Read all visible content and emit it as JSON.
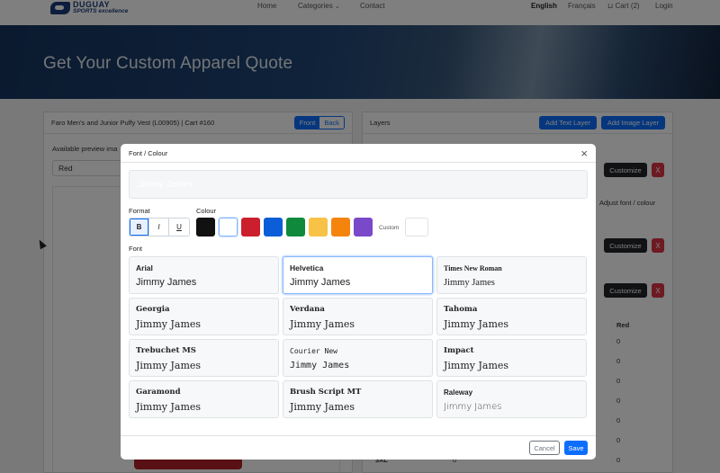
{
  "nav": {
    "logo_name": "DUGUAY",
    "logo_tagline": "SPORTS excellence",
    "links": [
      "Home",
      "Categories",
      "Contact"
    ],
    "lang_active": "English",
    "lang_other": "Français",
    "cart": "Cart (2)",
    "login": "Login"
  },
  "hero": {
    "title": "Get Your Custom Apparel Quote"
  },
  "product_panel": {
    "title": "Faro Men's and Junior Puffy Vest (L00905) | Cart #160",
    "front_label": "Front",
    "back_label": "Back",
    "preview_label": "Available preview ima",
    "color_value": "Red"
  },
  "layers_panel": {
    "title": "Layers",
    "add_text": "Add Text Layer",
    "add_image": "Add Image Layer",
    "customize_label": "Customize",
    "remove_label": "X",
    "hint": "Adjust font / colour",
    "column_header": "Red",
    "qty_values": [
      "0",
      "0",
      "0",
      "0",
      "0",
      "0",
      "0",
      "0"
    ],
    "size_partial": "3XL"
  },
  "modal": {
    "title": "Font / Colour",
    "close_glyph": "×",
    "preview_text": "Jimmy James",
    "format_label": "Format",
    "format_buttons": [
      "B",
      "I",
      "U"
    ],
    "colour_label": "Colour",
    "colours": [
      "#111111",
      "#ffffff",
      "#cc1f2d",
      "#0b5ed7",
      "#0f8a3c",
      "#f7c245",
      "#f5840c",
      "#7a49c9"
    ],
    "selected_colour": "#ffffff",
    "custom_label": "Custom",
    "font_label": "Font",
    "sample_text": "Jimmy James",
    "fonts": [
      {
        "name": "Arial"
      },
      {
        "name": "Helvetica"
      },
      {
        "name": "Times New Roman"
      },
      {
        "name": "Georgia"
      },
      {
        "name": "Verdana"
      },
      {
        "name": "Tahoma"
      },
      {
        "name": "Trebuchet MS"
      },
      {
        "name": "Courier New"
      },
      {
        "name": "Impact"
      },
      {
        "name": "Garamond"
      },
      {
        "name": "Brush Script MT"
      },
      {
        "name": "Raleway"
      }
    ],
    "selected_font": "Helvetica",
    "cancel_label": "Cancel",
    "save_label": "Save"
  }
}
